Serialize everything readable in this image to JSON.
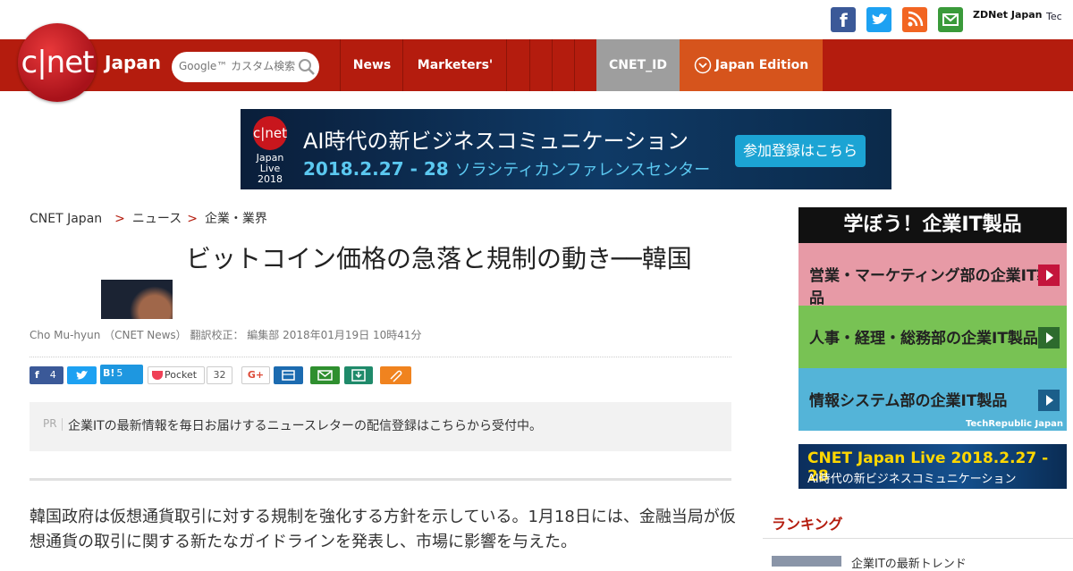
{
  "header": {
    "social_icons": [
      "facebook-icon",
      "twitter-icon",
      "rss-icon",
      "mail-icon"
    ],
    "zdnet_label": "ZDNet Japan",
    "techrepublic_label": "Tec"
  },
  "nav": {
    "logo_text": "c|net",
    "edition": "Japan",
    "search_placeholder": "Google™ カスタム検索",
    "items": [
      "News",
      "Marketers'"
    ],
    "cnet_id": "CNET_ID",
    "japan_edition": "Japan Edition"
  },
  "banner": {
    "logo_line1": "Japan",
    "logo_line2": "Live",
    "logo_line3": "2018",
    "title": "AI時代の新ビジネスコミュニケーション",
    "date": "2018.2.27 - 28",
    "venue": "ソラシティカンファレンスセンター",
    "cta": "参加登録はこちら"
  },
  "breadcrumb": [
    "CNET Japan",
    "ニュース",
    "企業・業界"
  ],
  "article": {
    "title": "ビットコイン価格の急落と規制の動き──韓国",
    "byline": "Cho Mu-hyun （CNET News） 翻訳校正： 編集部 2018年01月19日 10時41分",
    "share": {
      "facebook_count": "4",
      "hatena_count": "5",
      "pocket_label": "Pocket",
      "pocket_count": "32",
      "gplus_label": "G+"
    },
    "pr_tag": "PR",
    "pr_text": "企業ITの最新情報を毎日お届けするニュースレターの配信登録はこちらから受付中。",
    "body": "韓国政府は仮想通貨取引に対する規制を強化する方針を示している。1月18日には、金融当局が仮想通貨の取引に関する新たなガイドラインを発表し、市場に影響を与えた。"
  },
  "sidebar": {
    "ad_header": "学ぼう！企業IT製品",
    "ad_items": [
      {
        "label": "営業・マーケティング部の企業IT製品",
        "color": "#e79aa6"
      },
      {
        "label": "人事・経理・総務部の企業IT製品",
        "color": "#78c254"
      },
      {
        "label": "情報システム部の企業IT製品",
        "color": "#54b4d8"
      }
    ],
    "ad_footer": "TechRepublic Japan",
    "live_line1": "CNET Japan Live 2018.2.27 - 28",
    "live_line2": "AI時代の新ビジネスコミュニケーション",
    "ranking_title": "ランキング",
    "ranking_item": "企業ITの最新トレンド"
  }
}
